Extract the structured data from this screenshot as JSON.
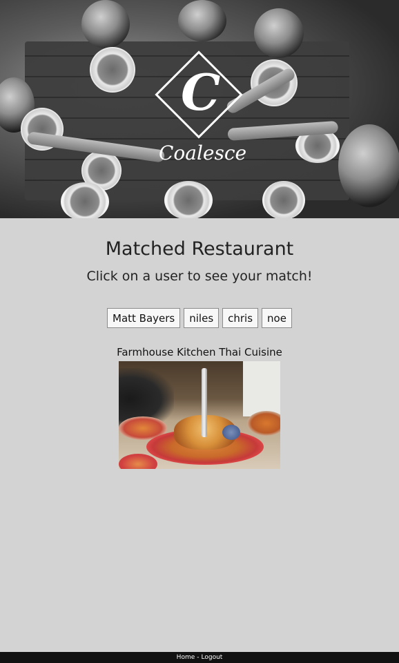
{
  "brand": {
    "logo_letter": "C",
    "logo_word": "Coalesce"
  },
  "main": {
    "title": "Matched Restaurant",
    "subtitle": "Click on a user to see your match!"
  },
  "users": [
    {
      "label": "Matt Bayers"
    },
    {
      "label": "niles"
    },
    {
      "label": "chris"
    },
    {
      "label": "noe"
    }
  ],
  "restaurant": {
    "name": "Farmhouse Kitchen Thai Cuisine"
  },
  "footer": {
    "home_label": "Home",
    "separator": "-",
    "logout_label": "Logout"
  },
  "colors": {
    "page_background": "#d3d3d3",
    "footer_background": "#111111",
    "button_background": "#f7f7f7"
  }
}
